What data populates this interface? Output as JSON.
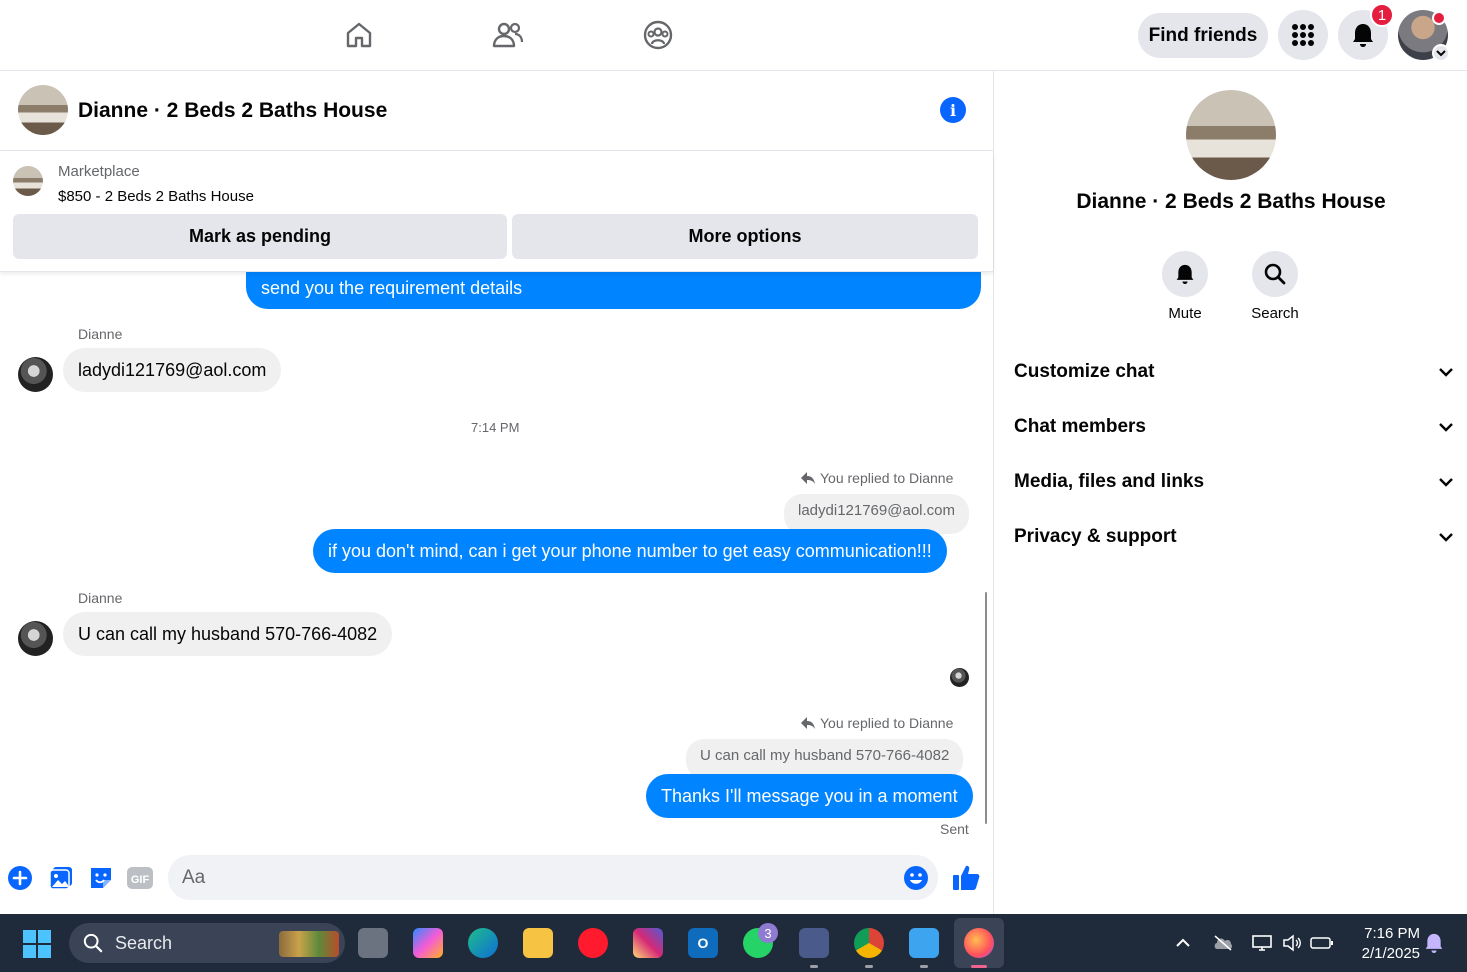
{
  "topnav": {
    "find_friends_label": "Find friends",
    "notification_count": "1"
  },
  "chat": {
    "title": "Dianne · 2 Beds 2 Baths House"
  },
  "marketplace": {
    "label": "Marketplace",
    "item": "$850 - 2 Beds 2 Baths House",
    "mark_pending_label": "Mark as pending",
    "more_options_label": "More options"
  },
  "messages": {
    "partial_out": "send you the requirement details",
    "sender_1": "Dianne",
    "in_1": "ladydi121769@aol.com",
    "timestamp": "7:14 PM",
    "replied_1": "You replied to Dianne",
    "quoted_1": "ladydi121769@aol.com",
    "out_1": "if you don't mind, can i get your phone number to get easy communication!!!",
    "sender_2": "Dianne",
    "in_2": "U can call my husband 570-766-4082",
    "replied_2": "You replied to Dianne",
    "quoted_2": "U can call my husband 570-766-4082",
    "out_2": "Thanks I'll message you in a moment",
    "status": "Sent"
  },
  "composer": {
    "placeholder": "Aa"
  },
  "right_panel": {
    "title": "Dianne · 2 Beds 2 Baths House",
    "mute_label": "Mute",
    "search_label": "Search",
    "sections": [
      {
        "label": "Customize chat"
      },
      {
        "label": "Chat members"
      },
      {
        "label": "Media, files and links"
      },
      {
        "label": "Privacy & support"
      }
    ]
  },
  "taskbar": {
    "search_label": "Search",
    "whatsapp_badge": "3",
    "time": "7:16 PM",
    "date": "2/1/2025"
  },
  "colors": {
    "accent": "#0866ff",
    "bubble_out": "#0084ff",
    "bubble_in": "#f0f0f0",
    "badge": "#e41e3f"
  }
}
